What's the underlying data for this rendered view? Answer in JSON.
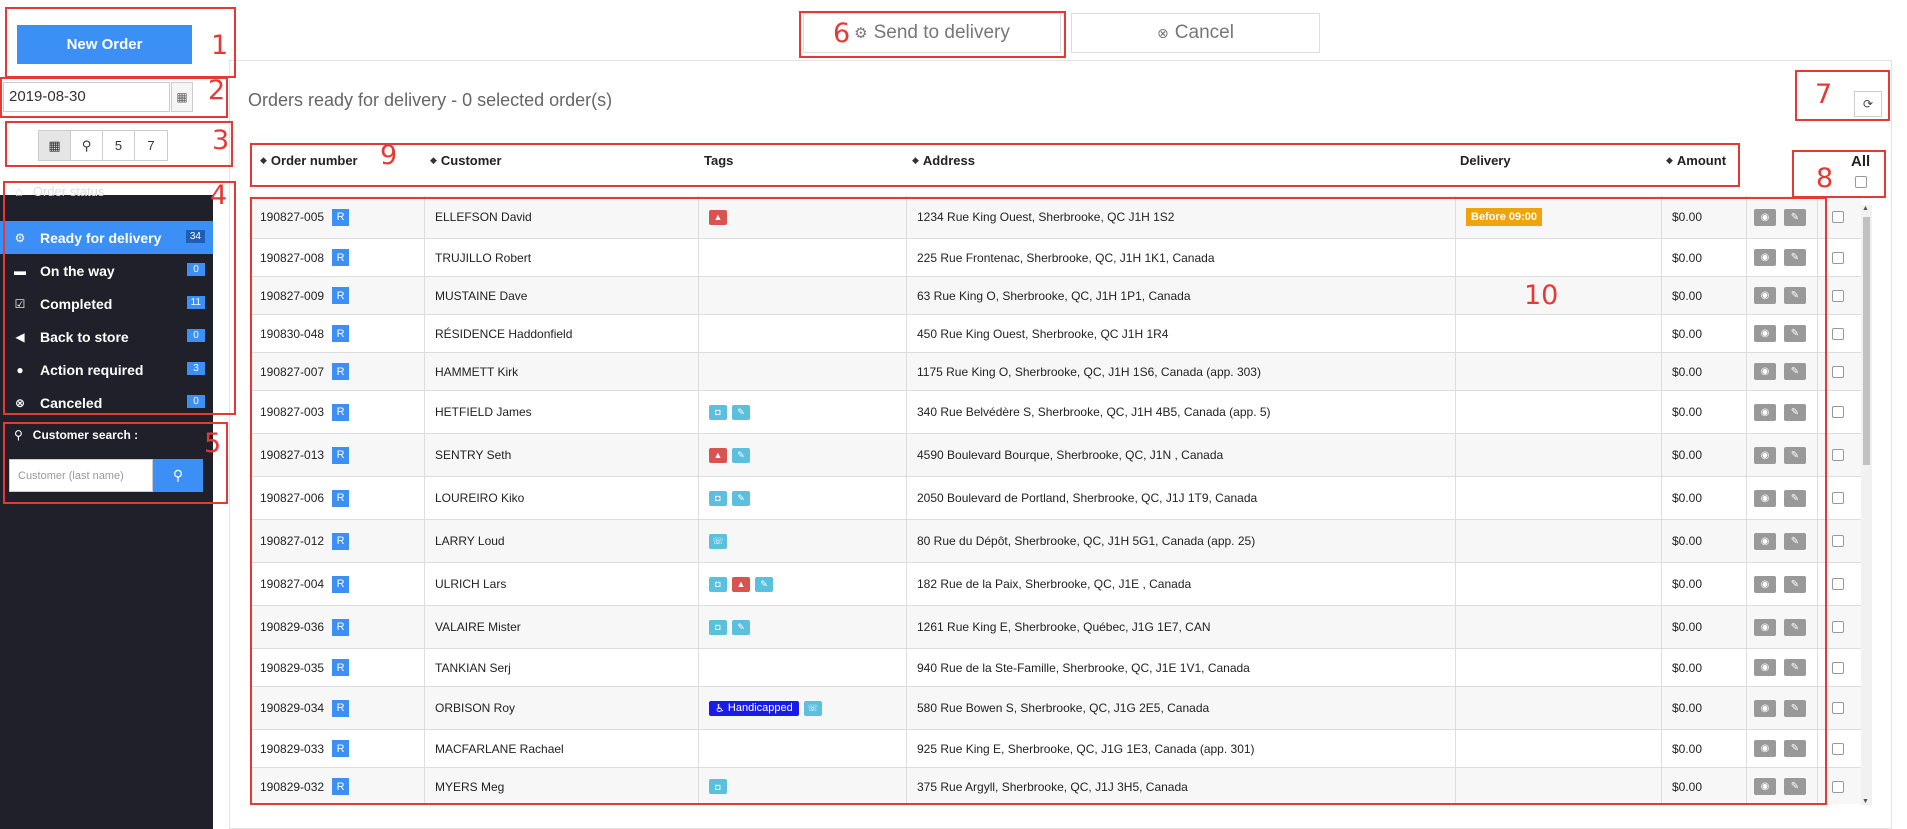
{
  "sidebar": {
    "new_order_label": "New Order",
    "date_value": "2019-08-30",
    "view_buttons": [
      "",
      "",
      "5",
      "7"
    ],
    "status_title": "Order status",
    "statuses": [
      {
        "label": "Ready for delivery",
        "count": "34",
        "icon": "bikes-icon"
      },
      {
        "label": "On the way",
        "count": "0",
        "icon": "car-icon"
      },
      {
        "label": "Completed",
        "count": "11",
        "icon": "checkbox-icon"
      },
      {
        "label": "Back to store",
        "count": "0",
        "icon": "arrow-left-circle-icon"
      },
      {
        "label": "Action required",
        "count": "3",
        "icon": "exclamation-circle-icon"
      },
      {
        "label": "Canceled",
        "count": "0",
        "icon": "x-circle-icon"
      }
    ],
    "customer_search_label": "Customer search :",
    "customer_search_placeholder": "Customer (last name)"
  },
  "toolbar": {
    "send_label": "Send to delivery",
    "cancel_label": "Cancel"
  },
  "main": {
    "title": "Orders ready for delivery - 0 selected order(s)"
  },
  "table": {
    "headers": [
      "Order number",
      "Customer",
      "Tags",
      "Address",
      "Delivery",
      "Amount"
    ],
    "all_label": "All",
    "rows": [
      {
        "order": "190827-005",
        "customer": "ELLEFSON David",
        "tags": [
          "warn"
        ],
        "address": "1234 Rue King Ouest, Sherbrooke, QC J1H 1S2",
        "delivery": "Before 09:00",
        "amount": "$0.00"
      },
      {
        "order": "190827-008",
        "customer": "TRUJILLO Robert",
        "tags": [],
        "address": "225 Rue Frontenac, Sherbrooke, QC, J1H 1K1, Canada",
        "delivery": "",
        "amount": "$0.00"
      },
      {
        "order": "190827-009",
        "customer": "MUSTAINE Dave",
        "tags": [],
        "address": "63 Rue King O, Sherbrooke, QC, J1H 1P1, Canada",
        "delivery": "",
        "amount": "$0.00"
      },
      {
        "order": "190830-048",
        "customer": "RÉSIDENCE Haddonfield",
        "tags": [],
        "address": "450 Rue King Ouest, Sherbrooke, QC J1H 1R4",
        "delivery": "",
        "amount": "$0.00"
      },
      {
        "order": "190827-007",
        "customer": "HAMMETT Kirk",
        "tags": [],
        "address": "1175 Rue King O, Sherbrooke, QC, J1H 1S6, Canada (app. 303)",
        "delivery": "",
        "amount": "$0.00"
      },
      {
        "order": "190827-003",
        "customer": "HETFIELD James",
        "tags": [
          "camera",
          "edit"
        ],
        "address": "340 Rue Belvédère S, Sherbrooke, QC, J1H 4B5, Canada (app. 5)",
        "delivery": "",
        "amount": "$0.00"
      },
      {
        "order": "190827-013",
        "customer": "SENTRY Seth",
        "tags": [
          "warn",
          "edit"
        ],
        "address": "4590 Boulevard Bourque, Sherbrooke, QC, J1N , Canada",
        "delivery": "",
        "amount": "$0.00"
      },
      {
        "order": "190827-006",
        "customer": "LOUREIRO Kiko",
        "tags": [
          "camera",
          "edit"
        ],
        "address": "2050 Boulevard de Portland, Sherbrooke, QC, J1J 1T9, Canada",
        "delivery": "",
        "amount": "$0.00"
      },
      {
        "order": "190827-012",
        "customer": "LARRY Loud",
        "tags": [
          "phone"
        ],
        "address": "80 Rue du Dépôt, Sherbrooke, QC, J1H 5G1, Canada (app. 25)",
        "delivery": "",
        "amount": "$0.00"
      },
      {
        "order": "190827-004",
        "customer": "ULRICH Lars",
        "tags": [
          "camera",
          "warn",
          "edit"
        ],
        "address": "182 Rue de la Paix, Sherbrooke, QC, J1E , Canada",
        "delivery": "",
        "amount": "$0.00"
      },
      {
        "order": "190829-036",
        "customer": "VALAIRE Mister",
        "tags": [
          "camera",
          "edit"
        ],
        "address": "1261 Rue King E, Sherbrooke, Québec, J1G 1E7, CAN",
        "delivery": "",
        "amount": "$0.00"
      },
      {
        "order": "190829-035",
        "customer": "TANKIAN Serj",
        "tags": [],
        "address": "940 Rue de la Ste-Famille, Sherbrooke, QC, J1E 1V1, Canada",
        "delivery": "",
        "amount": "$0.00"
      },
      {
        "order": "190829-034",
        "customer": "ORBISON Roy",
        "tags": [
          "handicapped",
          "phone"
        ],
        "address": "580 Rue Bowen S, Sherbrooke, QC, J1G 2E5, Canada",
        "delivery": "",
        "amount": "$0.00"
      },
      {
        "order": "190829-033",
        "customer": "MACFARLANE Rachael",
        "tags": [],
        "address": "925 Rue King E, Sherbrooke, QC, J1G 1E3, Canada (app. 301)",
        "delivery": "",
        "amount": "$0.00"
      },
      {
        "order": "190829-032",
        "customer": "MYERS Meg",
        "tags": [
          "camera"
        ],
        "address": "375 Rue Argyll, Sherbrooke, QC, J1J 3H5, Canada",
        "delivery": "",
        "amount": "$0.00"
      }
    ],
    "handicapped_label": "Handicapped",
    "row_badge": "R"
  },
  "annotations": [
    "1",
    "2",
    "3",
    "4",
    "5",
    "6",
    "7",
    "8",
    "9",
    "10"
  ],
  "colors": {
    "accent": "#3b8ff5",
    "sidebar": "#1f2029",
    "annotation": "#e53935",
    "warning": "#d9534f",
    "info": "#5bc0de",
    "delivery_badge": "#f0a30a"
  }
}
